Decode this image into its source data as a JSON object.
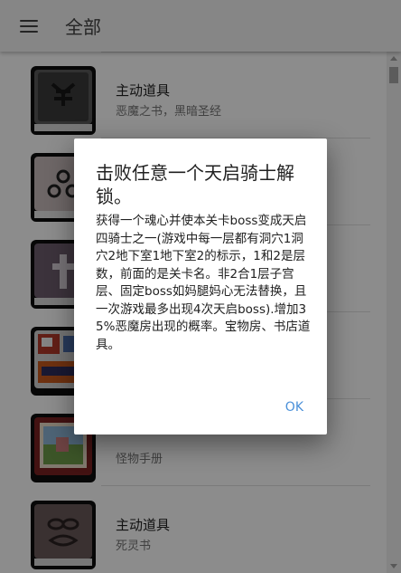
{
  "appbar": {
    "title": "全部",
    "menu_icon": "hamburger-menu-icon"
  },
  "list": {
    "items": [
      {
        "title": "主动道具",
        "subtitle": "恶魔之书，黑暗圣经",
        "icon": "demon-book-icon"
      },
      {
        "title": "",
        "subtitle": "",
        "icon": "triad-book-icon"
      },
      {
        "title": "",
        "subtitle": "",
        "icon": "cross-book-icon"
      },
      {
        "title": "",
        "subtitle": "",
        "icon": "pixel-comic-book-icon"
      },
      {
        "title": "",
        "subtitle": "怪物手册",
        "icon": "monster-manual-icon"
      },
      {
        "title": "主动道具",
        "subtitle": "死灵书",
        "icon": "necronomicon-icon"
      }
    ]
  },
  "dialog": {
    "title": "击败任意一个天启骑士解锁。",
    "body": "获得一个魂心并使本关卡boss变成天启四骑士之一(游戏中每一层都有洞穴1洞穴2地下室1地下室2的标示，1和2是层数，前面的是关卡名。非2合1层子宫层、固定boss如妈腿妈心无法替换，且一次游戏最多出现4次天启boss).增加35%恶魔房出现的概率。宝物房、书店道具。",
    "ok_label": "OK",
    "accent": "#4a90d9"
  }
}
